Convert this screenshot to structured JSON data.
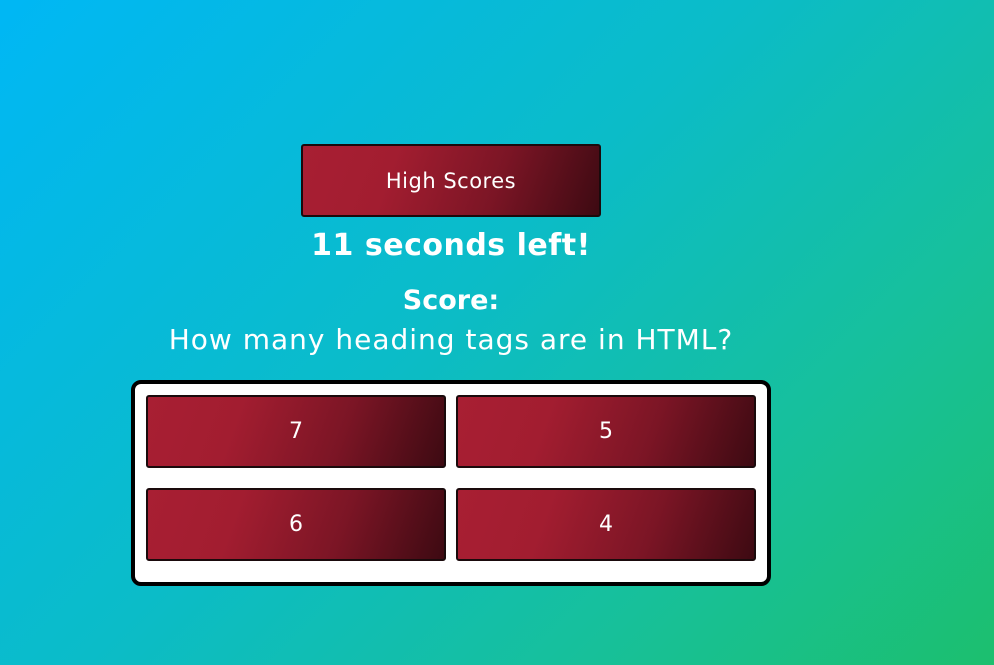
{
  "header": {
    "high_scores_label": "High Scores"
  },
  "timer": {
    "text": "11 seconds left!"
  },
  "score": {
    "label": "Score:"
  },
  "quiz": {
    "question": "How many heading tags are in HTML?",
    "answers": [
      "7",
      "5",
      "6",
      "4"
    ]
  },
  "colors": {
    "background_start": "#00b7f5",
    "background_end": "#1cbf6e",
    "button_start": "#a81f33",
    "button_end": "#3d0a12",
    "text": "#ffffff"
  }
}
